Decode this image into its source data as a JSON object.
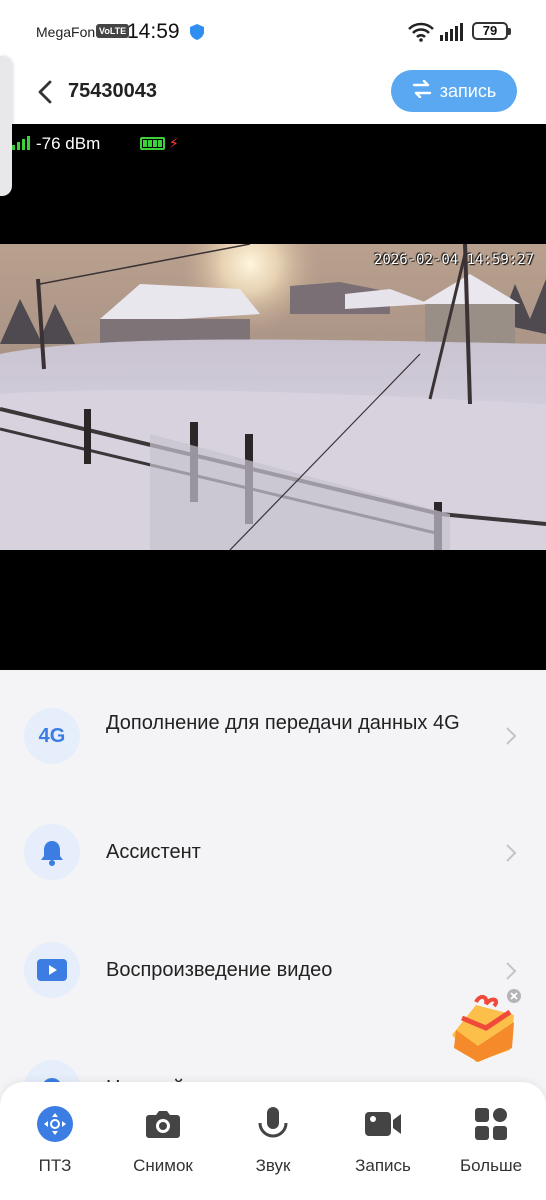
{
  "status_bar": {
    "carrier": "MegaFon",
    "volte": "VoLTE",
    "time": "14:59",
    "battery": "79"
  },
  "header": {
    "device_id": "75430043",
    "record_button_label": "запись"
  },
  "video": {
    "signal_text": "-76 dBm",
    "timestamp": "2026-02-04 14:59:27"
  },
  "menu": {
    "items": [
      {
        "label": "Дополнение для передачи данных 4G",
        "icon": "4g-icon",
        "icon_text": "4G"
      },
      {
        "label": "Ассистент",
        "icon": "bell-icon"
      },
      {
        "label": "Воспроизведение видео",
        "icon": "play-icon"
      },
      {
        "label": "Настройки",
        "icon": "settings-icon"
      }
    ]
  },
  "tabs": [
    {
      "label": "ПТЗ",
      "icon": "ptz-icon"
    },
    {
      "label": "Снимок",
      "icon": "camera-icon"
    },
    {
      "label": "Звук",
      "icon": "microphone-icon"
    },
    {
      "label": "Запись",
      "icon": "video-record-icon"
    },
    {
      "label": "Больше",
      "icon": "grid-more-icon"
    }
  ],
  "colors": {
    "accent": "#3b7de3",
    "record_pill": "#5aa7f2",
    "signal_green": "#3bd13b"
  }
}
